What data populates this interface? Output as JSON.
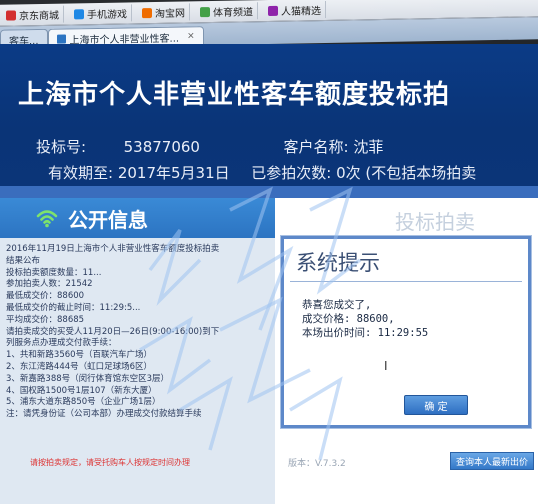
{
  "browser": {
    "bookmarks": [
      {
        "label": "京东商城",
        "color": "#d32f2f"
      },
      {
        "label": "手机游戏",
        "color": "#1e88e5"
      },
      {
        "label": "淘宝网",
        "color": "#ef6c00"
      },
      {
        "label": "体育频道",
        "color": "#43a047"
      },
      {
        "label": "人猫精选",
        "color": "#8e24aa"
      }
    ],
    "tabs": [
      {
        "label": "客车...",
        "active": false
      },
      {
        "label": "上海市个人非营业性客...",
        "active": true
      }
    ],
    "close_glyph": "×"
  },
  "header": {
    "title": "上海市个人非营业性客车额度投标拍",
    "bid_number_label": "投标号:",
    "bid_number": "53877060",
    "customer_label": "客户名称:",
    "customer_name": "沈菲",
    "expiry_label": "有效期至:",
    "expiry_date": "2017年5月31日",
    "attempts_label": "已参拍次数:",
    "attempts_value": "0次",
    "attempts_note": "(不包括本场拍卖"
  },
  "left_panel": {
    "heading": "公开信息",
    "icon": "wifi-icon",
    "notice_lines": [
      "2016年11月19日上海市个人非营业性客车额度投标拍卖",
      "结果公布",
      "投标拍卖额度数量：11...",
      "参加拍卖人数：21542",
      "最低成交价：88600",
      "最低成交价的截止时间：11:29:5...",
      "平均成交价：88685",
      "请拍卖成交的买受人11月20日—26日(9:00-16:00)到下",
      "列服务点办理成交付款手续：",
      "1、共和新路3560号（百联汽车广场）",
      "2、东江湾路444号（虹口足球场6区）",
      "3、新嘉路388号（闵行体育馆东空区3层）",
      "4、国权路1500号1层107（新东大厦）",
      "5、浦东大道东路850号（企业广场1层）",
      "注：请凭身份证（公司本部）办理成交付款结算手续"
    ],
    "bottom_note": "请按拍卖规定，请受托购车人按规定时间办理"
  },
  "right_panel": {
    "heading": "投标拍卖"
  },
  "dialog": {
    "title": "系统提示",
    "line1": "恭喜您成交了,",
    "line2": "成交价格: 88600,",
    "line3": "本场出价时间: 11:29:55",
    "cursor": "I",
    "ok_label": "确 定"
  },
  "footer": {
    "version": "版本：V.7.3.2",
    "query_button": "查询本人最新出价"
  },
  "colors": {
    "header_bg": "#0b3b86",
    "accent": "#2c74c2",
    "dialog_border": "#5d88c9",
    "watermark": "#9ec3f0"
  }
}
